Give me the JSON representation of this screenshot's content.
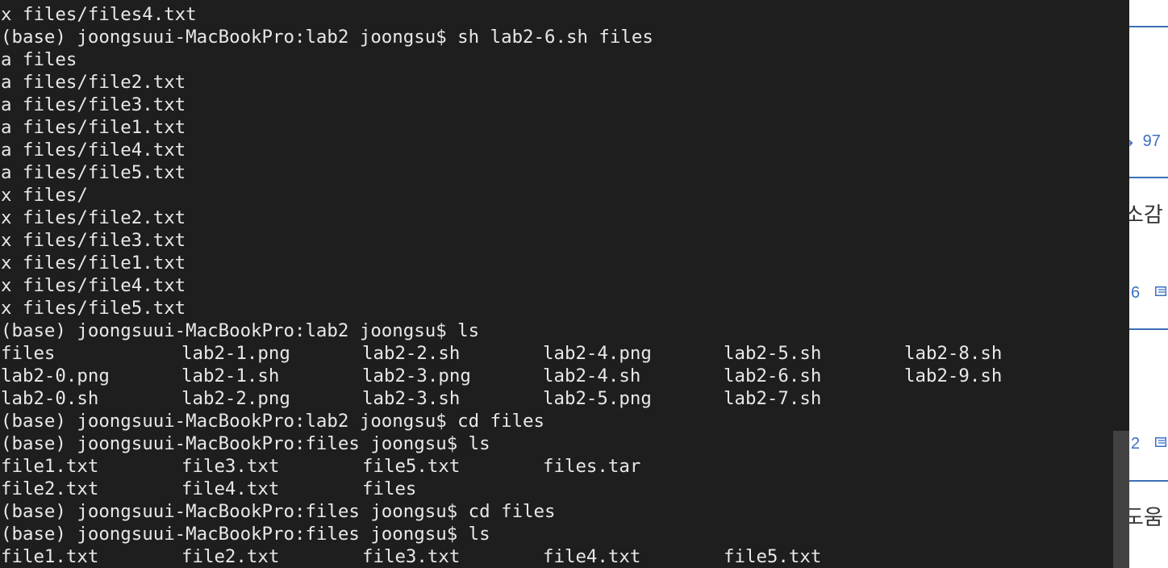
{
  "terminal": {
    "lines": [
      "x files/files4.txt",
      "(base) joongsuui-MacBookPro:lab2 joongsu$ sh lab2-6.sh files",
      "a files",
      "a files/file2.txt",
      "a files/file3.txt",
      "a files/file1.txt",
      "a files/file4.txt",
      "a files/file5.txt",
      "x files/",
      "x files/file2.txt",
      "x files/file3.txt",
      "x files/file1.txt",
      "x files/file4.txt",
      "x files/file5.txt",
      "(base) joongsuui-MacBookPro:lab2 joongsu$ ls"
    ],
    "ls_lab2": [
      [
        "files",
        "lab2-1.png",
        "lab2-2.sh",
        "lab2-4.png",
        "lab2-5.sh",
        "lab2-8.sh"
      ],
      [
        "lab2-0.png",
        "lab2-1.sh",
        "lab2-3.png",
        "lab2-4.sh",
        "lab2-6.sh",
        "lab2-9.sh"
      ],
      [
        "lab2-0.sh",
        "lab2-2.png",
        "lab2-3.sh",
        "lab2-5.png",
        "lab2-7.sh"
      ]
    ],
    "prompt_cd_files": "(base) joongsuui-MacBookPro:lab2 joongsu$ cd files",
    "prompt_ls_files": "(base) joongsuui-MacBookPro:files joongsu$ ls",
    "ls_files": [
      [
        "file1.txt",
        "file3.txt",
        "file5.txt",
        "files.tar"
      ],
      [
        "file2.txt",
        "file4.txt",
        "files"
      ]
    ],
    "prompt_cd_files2": "(base) joongsuui-MacBookPro:files joongsu$ cd files",
    "prompt_ls_files2": "(base) joongsuui-MacBookPro:files joongsu$ ls",
    "ls_files2": [
      [
        "file1.txt",
        "file2.txt",
        "file3.txt",
        "file4.txt",
        "file5.txt"
      ]
    ]
  },
  "side_panel": {
    "count_1": "97",
    "text_1": "소감",
    "count_2": "6",
    "count_3": "2",
    "text_2": "도움",
    "icon_name": "document-icon",
    "accent_color": "#3b6fc2"
  }
}
